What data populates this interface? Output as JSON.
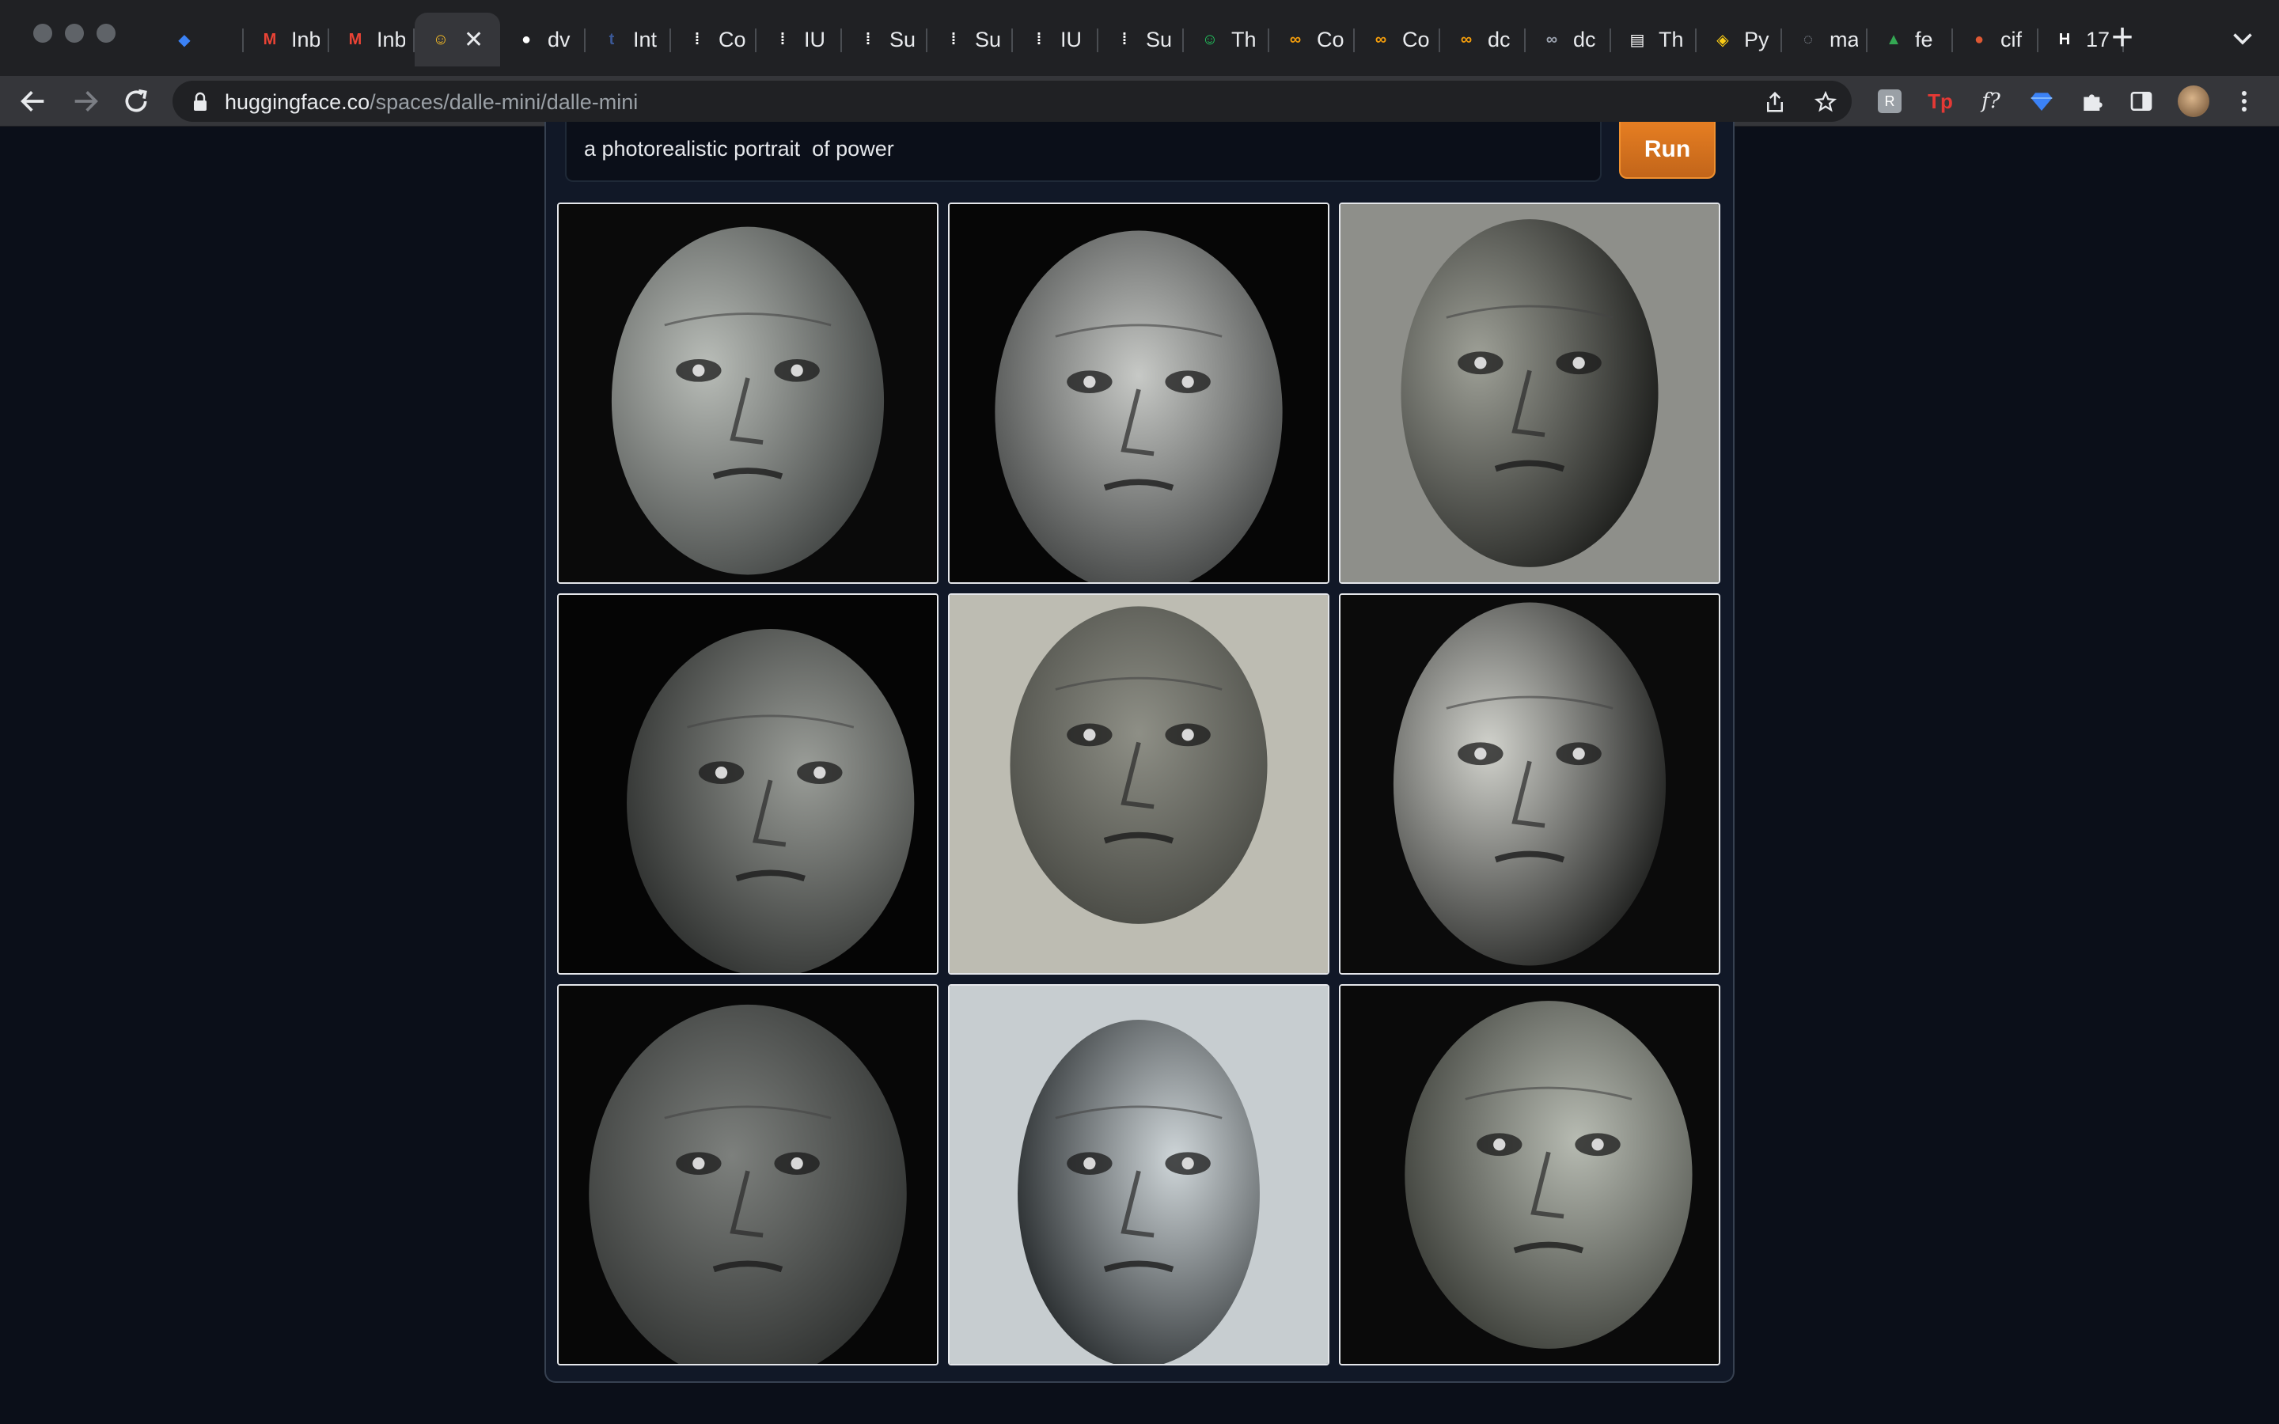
{
  "browser": {
    "tabs": [
      {
        "title": "",
        "favicon": "diamond-icon",
        "color": "#3b82f6"
      },
      {
        "title": "Inbox",
        "favicon": "gmail-icon",
        "color": "#ea4335"
      },
      {
        "title": "Inbox",
        "favicon": "gmail-icon",
        "color": "#ea4335"
      },
      {
        "title": "",
        "favicon": "hugging-face-icon",
        "color": "#fbbf24",
        "active": true
      },
      {
        "title": "dv",
        "favicon": "github-icon",
        "color": "#ffffff"
      },
      {
        "title": "Int",
        "favicon": "tds-icon",
        "color": "#3b5998"
      },
      {
        "title": "Co",
        "favicon": "dots-icon",
        "color": "#ffffff"
      },
      {
        "title": "IU",
        "favicon": "dots-icon",
        "color": "#ffffff"
      },
      {
        "title": "Su",
        "favicon": "dots-icon",
        "color": "#ffffff"
      },
      {
        "title": "Su",
        "favicon": "dots-icon",
        "color": "#ffffff"
      },
      {
        "title": "IU",
        "favicon": "dots-icon",
        "color": "#ffffff"
      },
      {
        "title": "Su",
        "favicon": "dots-icon",
        "color": "#ffffff"
      },
      {
        "title": "Th",
        "favicon": "smiley-icon",
        "color": "#22c55e"
      },
      {
        "title": "Co",
        "favicon": "infinity-icon",
        "color": "#f59e0b"
      },
      {
        "title": "Co",
        "favicon": "infinity-icon",
        "color": "#f59e0b"
      },
      {
        "title": "dc",
        "favicon": "infinity-icon",
        "color": "#f59e0b"
      },
      {
        "title": "dc",
        "favicon": "infinity-icon",
        "color": "#9ca3af"
      },
      {
        "title": "Th",
        "favicon": "document-icon",
        "color": "#ffffff"
      },
      {
        "title": "Py",
        "favicon": "python-icon",
        "color": "#facc15"
      },
      {
        "title": "ma",
        "favicon": "loading-icon",
        "color": "#9ca3af"
      },
      {
        "title": "fe",
        "favicon": "drive-icon",
        "color": "#34a853"
      },
      {
        "title": "cif",
        "favicon": "duckduckgo-icon",
        "color": "#de5833"
      },
      {
        "title": "17",
        "favicon": "hp-icon",
        "color": "#ffffff"
      }
    ],
    "url_host": "huggingface.co",
    "url_path": "/spaces/dalle-mini/dalle-mini"
  },
  "app": {
    "prompt_value": "a photorealistic portrait  of power",
    "run_label": "Run",
    "accent_color": "#e67e22"
  },
  "results": {
    "images": [
      {
        "description": "portrait-1"
      },
      {
        "description": "portrait-2"
      },
      {
        "description": "portrait-3"
      },
      {
        "description": "portrait-4"
      },
      {
        "description": "portrait-5"
      },
      {
        "description": "portrait-6"
      },
      {
        "description": "portrait-7"
      },
      {
        "description": "portrait-8"
      },
      {
        "description": "portrait-9"
      }
    ]
  }
}
